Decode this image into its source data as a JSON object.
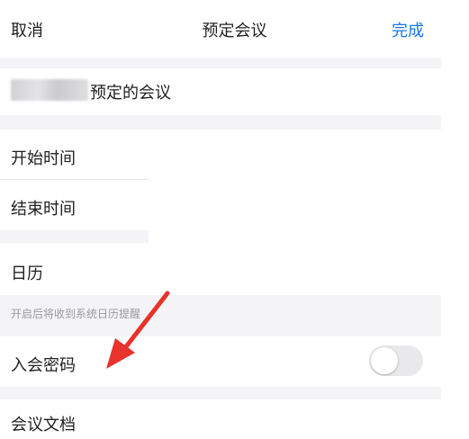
{
  "nav": {
    "cancel_label": "取消",
    "title": "预定会议",
    "done_label": "完成"
  },
  "topic": {
    "suffix": "预定的会议"
  },
  "rows": {
    "start_time": "开始时间",
    "end_time": "结束时间",
    "calendar": "日历",
    "calendar_hint": "开启后将收到系统日历提醒",
    "meeting_password": "入会密码",
    "meeting_docs": "会议文档"
  },
  "toggle": {
    "meeting_password_enabled": false
  },
  "colors": {
    "accent": "#1677f0",
    "annotation_arrow": "#e8322b",
    "band": "#f4f4f6"
  }
}
